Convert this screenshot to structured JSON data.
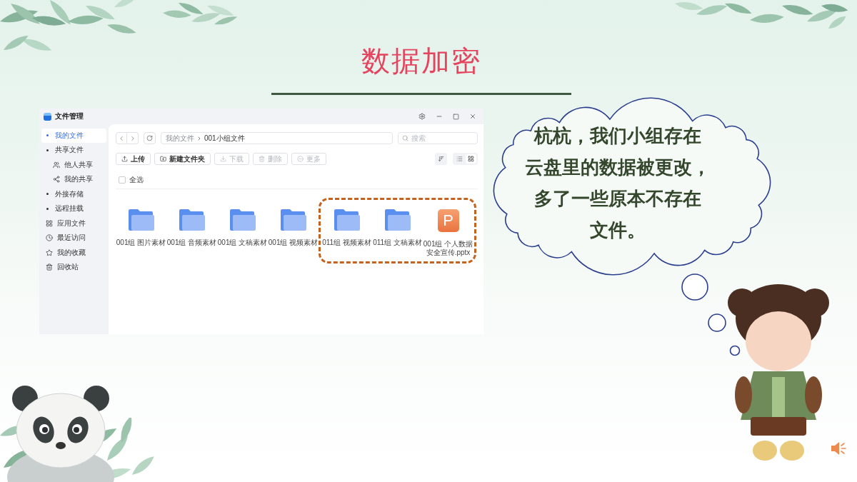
{
  "title": "数据加密",
  "file_manager": {
    "window": {
      "title": "文件管理"
    },
    "sidebar": {
      "items": [
        {
          "label": "我的文件",
          "kind": "folder",
          "selected": true
        },
        {
          "label": "共享文件",
          "kind": "folder",
          "selected": false,
          "children": [
            {
              "label": "他人共享",
              "kind": "received",
              "selected": false
            },
            {
              "label": "我的共享",
              "kind": "shared",
              "selected": false
            }
          ]
        },
        {
          "label": "外接存储",
          "kind": "folder",
          "selected": false
        },
        {
          "label": "远程挂载",
          "kind": "folder",
          "selected": false
        },
        {
          "label": "应用文件",
          "kind": "apps",
          "selected": false
        },
        {
          "label": "最近访问",
          "kind": "recent",
          "selected": false
        },
        {
          "label": "我的收藏",
          "kind": "favorites",
          "selected": false
        },
        {
          "label": "回收站",
          "kind": "trash",
          "selected": false
        }
      ]
    },
    "breadcrumb": [
      "我的文件",
      "001小组文件"
    ],
    "search": {
      "placeholder": "搜索"
    },
    "toolbar": {
      "buttons": [
        {
          "label": "上传",
          "kind": "upload",
          "disabled": false
        },
        {
          "label": "新建文件夹",
          "kind": "new-folder",
          "disabled": false
        },
        {
          "label": "下载",
          "kind": "download",
          "disabled": true
        },
        {
          "label": "删除",
          "kind": "delete",
          "disabled": true
        },
        {
          "label": "更多",
          "kind": "more",
          "disabled": true
        }
      ]
    },
    "views": [
      {
        "kind": "list",
        "selected": false
      },
      {
        "kind": "grid",
        "selected": true
      }
    ],
    "select_all": {
      "label": "全选",
      "checked": false
    },
    "files": [
      {
        "name": "001组 图片素材",
        "kind": "folder",
        "highlighted": false
      },
      {
        "name": "001组 音频素材",
        "kind": "folder",
        "highlighted": false
      },
      {
        "name": "001组 文稿素材",
        "kind": "folder",
        "highlighted": false
      },
      {
        "name": "001组 视频素材",
        "kind": "folder",
        "highlighted": false
      },
      {
        "name": "011组 视频素材",
        "kind": "folder",
        "highlighted": true
      },
      {
        "name": "011组 文稿素材",
        "kind": "folder",
        "highlighted": true
      },
      {
        "name": "001组 个人数据安全宣传.pptx",
        "kind": "pptx",
        "icon_letter": "P",
        "highlighted": true
      }
    ]
  },
  "speech_bubble": {
    "lines": [
      "杭杭，我们小组存在",
      "云盘里的数据被更改，",
      "多了一些原本不存在",
      "文件。"
    ]
  }
}
